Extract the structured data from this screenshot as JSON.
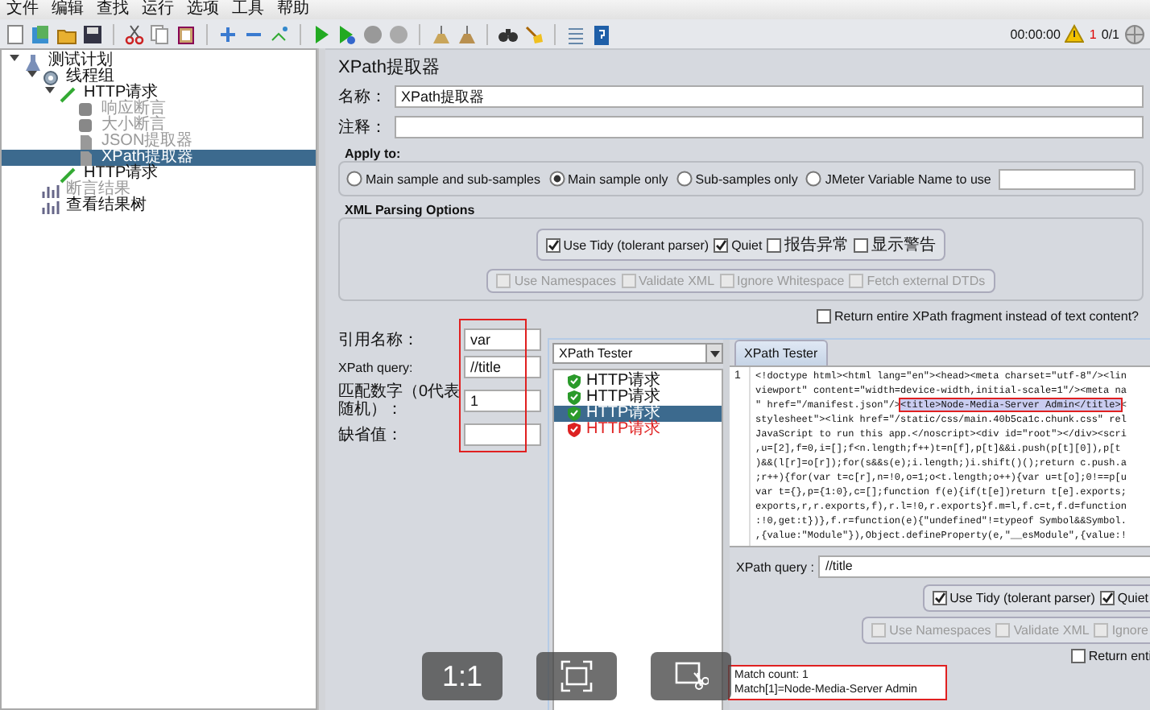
{
  "menu": [
    "文件",
    "编辑",
    "查找",
    "运行",
    "选项",
    "工具",
    "帮助"
  ],
  "status": {
    "timer": "00:00:00",
    "error_count": "1",
    "threads": "0/1"
  },
  "tree": [
    {
      "label": "测试计划",
      "kind": "plan",
      "expanded": true,
      "selected": false,
      "disabled": false,
      "children": [
        {
          "label": "线程组",
          "kind": "threads",
          "expanded": true,
          "selected": false,
          "disabled": false,
          "children": [
            {
              "label": "HTTP请求",
              "kind": "sampler",
              "expanded": true,
              "selected": false,
              "disabled": false,
              "children": [
                {
                  "label": "响应断言",
                  "kind": "assertion",
                  "selected": false,
                  "disabled": true
                },
                {
                  "label": "大小断言",
                  "kind": "assertion",
                  "selected": false,
                  "disabled": true
                },
                {
                  "label": "JSON提取器",
                  "kind": "extractor",
                  "selected": false,
                  "disabled": true
                },
                {
                  "label": "XPath提取器",
                  "kind": "extractor",
                  "selected": true,
                  "disabled": false
                }
              ]
            },
            {
              "label": "HTTP请求",
              "kind": "sampler",
              "selected": false,
              "disabled": false
            }
          ]
        },
        {
          "label": "断言结果",
          "kind": "listener",
          "selected": false,
          "disabled": true
        },
        {
          "label": "查看结果树",
          "kind": "listener",
          "selected": false,
          "disabled": false
        }
      ]
    }
  ],
  "editor": {
    "title": "XPath提取器",
    "name": {
      "label": "名称：",
      "value": "XPath提取器"
    },
    "comment": {
      "label": "注释："
    },
    "apply_to": {
      "legend": "Apply to:",
      "options": [
        {
          "label": "Main sample and sub-samples",
          "selected": false
        },
        {
          "label": "Main sample only",
          "selected": true
        },
        {
          "label": "Sub-samples only",
          "selected": false
        },
        {
          "label": "JMeter Variable Name to use",
          "selected": false
        }
      ]
    },
    "xml_parsing": {
      "legend": "XML Parsing Options",
      "tidy_options": [
        {
          "label": "Use Tidy (tolerant parser)",
          "checked": true,
          "disabled": false
        },
        {
          "label": "Quiet",
          "checked": true,
          "disabled": false
        },
        {
          "label": "报告异常",
          "checked": false,
          "disabled": false
        },
        {
          "label": "显示警告",
          "checked": false,
          "disabled": false
        }
      ],
      "namespace_options": [
        {
          "label": "Use Namespaces",
          "checked": false,
          "disabled": true
        },
        {
          "label": "Validate XML",
          "checked": false,
          "disabled": true
        },
        {
          "label": "Ignore Whitespace",
          "checked": false,
          "disabled": true
        },
        {
          "label": "Fetch external DTDs",
          "checked": false,
          "disabled": true
        }
      ]
    },
    "return_fragment": {
      "label": "Return entire XPath fragment instead of text content?",
      "checked": false
    },
    "fields_highlighted": true,
    "fields": [
      {
        "label": "引用名称：",
        "value": "var"
      },
      {
        "label": "XPath query:",
        "value": "//title"
      },
      {
        "label": "匹配数字（0代表随机）：",
        "value": "1"
      },
      {
        "label": "缺省值："
      }
    ]
  },
  "tester": {
    "dropdown": "XPath Tester",
    "samples": [
      {
        "label": "HTTP请求",
        "kind": "success",
        "selected": false
      },
      {
        "label": "HTTP请求",
        "kind": "success",
        "selected": false
      },
      {
        "label": "HTTP请求",
        "kind": "success",
        "selected": true
      },
      {
        "label": "HTTP请求",
        "kind": "error",
        "selected": false
      }
    ],
    "tabs": [
      {
        "label": "XPath Tester",
        "selected": true
      }
    ],
    "line_numbers": [
      "1"
    ],
    "code_lines": [
      [
        {
          "text": "<!doctype html><html lang=\"en\"><head><meta charset=\"utf-8\"/><lin",
          "highlighted": false
        }
      ],
      [
        {
          "text": "viewport\" content=\"width=device-width,initial-scale=1\"/><meta na",
          "highlighted": false
        }
      ],
      [
        {
          "text": "\" href=\"/manifest.json\"/>",
          "highlighted": false
        },
        {
          "text": "<title>Node-Media-Server Admin</title>",
          "highlighted": true
        },
        {
          "text": "<",
          "highlighted": false
        }
      ],
      [
        {
          "text": "stylesheet\"><link href=\"/static/css/main.40b5ca1c.chunk.css\" rel",
          "highlighted": false
        }
      ],
      [
        {
          "text": "JavaScript to run this app.</noscript><div id=\"root\"></div><scri",
          "highlighted": false
        }
      ],
      [
        {
          "text": ",u=[2],f=0,i=[];f<n.length;f++)t=n[f],p[t]&&i.push(p[t][0]),p[t",
          "highlighted": false
        }
      ],
      [
        {
          "text": ")&&(l[r]=o[r]);for(s&&s(e);i.length;)i.shift()();return c.push.a",
          "highlighted": false
        }
      ],
      [
        {
          "text": ";r++){for(var t=c[r],n=!0,o=1;o<t.length;o++){var u=t[o];0!==p[u",
          "highlighted": false
        }
      ],
      [
        {
          "text": "var t={},p={1:0},c=[];function f(e){if(t[e])return t[e].exports;",
          "highlighted": false
        }
      ],
      [
        {
          "text": "exports,r,r.exports,f),r.l=!0,r.exports}f.m=l,f.c=t,f.d=function",
          "highlighted": false
        }
      ],
      [
        {
          "text": ":!0,get:t})},f.r=function(e){\"undefined\"!=typeof Symbol&&Symbol.",
          "highlighted": false
        }
      ],
      [
        {
          "text": ",{value:\"Module\"}),Object.defineProperty(e,\"__esModule\",{value:!",
          "highlighted": false
        }
      ]
    ],
    "query": {
      "label": "XPath query :",
      "value": "//title"
    },
    "tidy_options": [
      {
        "label": "Use Tidy (tolerant parser)",
        "checked": true,
        "disabled": false
      },
      {
        "label": "Quiet",
        "checked": true,
        "disabled": false
      }
    ],
    "namespace_options": [
      {
        "label": "Use Namespaces",
        "checked": false,
        "disabled": true
      },
      {
        "label": "Validate XML",
        "checked": false,
        "disabled": true
      },
      {
        "label": "Ignore",
        "checked": false,
        "disabled": true
      }
    ],
    "return_fragment": {
      "label": "Return enti",
      "checked": false
    },
    "results_highlighted": true,
    "results": [
      "Match count: 1",
      "Match[1]=Node-Media-Server Admin"
    ]
  },
  "viewer_controls": [
    {
      "kind": "actual-size",
      "label": "1:1"
    },
    {
      "kind": "fit"
    },
    {
      "kind": "crop"
    }
  ]
}
